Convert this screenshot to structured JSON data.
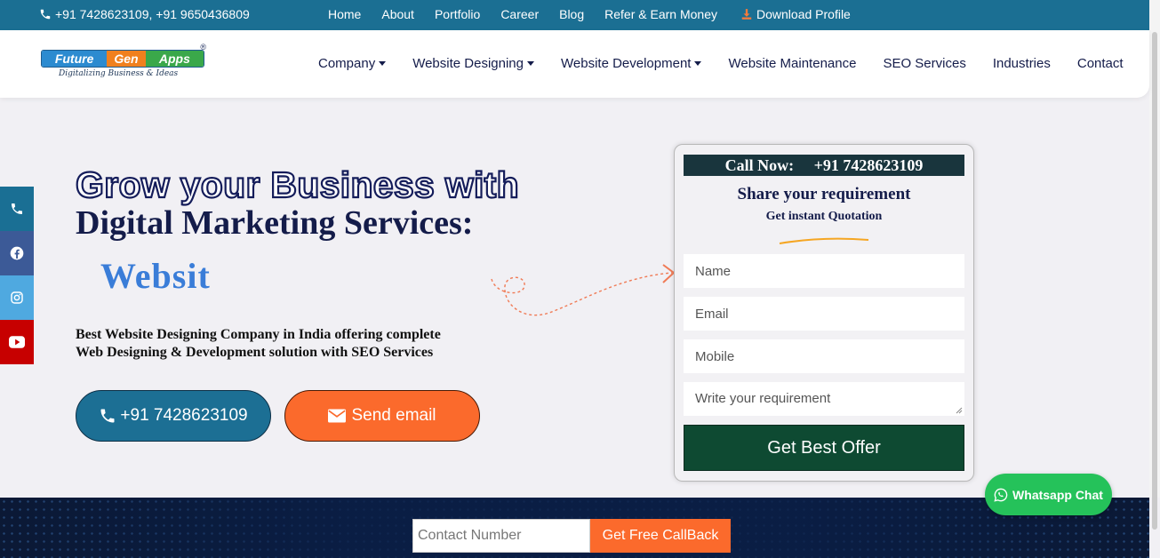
{
  "topbar": {
    "phones": "+91 7428623109, +91 9650436809",
    "links": [
      "Home",
      "About",
      "Portfolio",
      "Career",
      "Blog",
      "Refer & Earn Money"
    ],
    "download": "Download Profile"
  },
  "logo": {
    "part1": "Future",
    "part2": "Gen",
    "part3": "Apps",
    "tagline": "Digitalizing Business & Ideas",
    "reg": "®"
  },
  "nav": {
    "items": [
      {
        "label": "Company",
        "dropdown": true
      },
      {
        "label": "Website Designing",
        "dropdown": true
      },
      {
        "label": "Website Development",
        "dropdown": true
      },
      {
        "label": "Website Maintenance",
        "dropdown": false
      },
      {
        "label": "SEO Services",
        "dropdown": false
      },
      {
        "label": "Industries",
        "dropdown": false
      },
      {
        "label": "Contact",
        "dropdown": false
      }
    ]
  },
  "hero": {
    "title_line1": "Grow your Business with",
    "title_line2": "Digital Marketing Services:",
    "typed_text": "Websit",
    "description_line1": "Best Website Designing Company in India offering complete",
    "description_line2": "Web Designing & Development solution with SEO Services",
    "call_button": "+91 7428623109",
    "email_button": "Send email"
  },
  "form": {
    "call_now": "Call Now:     +91 7428623109",
    "heading": "Share your requirement",
    "subheading": "Get instant Quotation",
    "name_placeholder": "Name",
    "email_placeholder": "Email",
    "mobile_placeholder": "Mobile",
    "requirement_placeholder": "Write your requirement",
    "submit": "Get Best Offer"
  },
  "callback": {
    "placeholder": "Contact Number",
    "button": "Get Free CallBack"
  },
  "whatsapp": "Whatsapp Chat",
  "colors": {
    "topbar": "#1b6f93",
    "accent_orange": "#fb6a2c",
    "form_submit": "#0e4a32",
    "whatsapp": "#25c25a",
    "navy_text": "#141c4a"
  }
}
